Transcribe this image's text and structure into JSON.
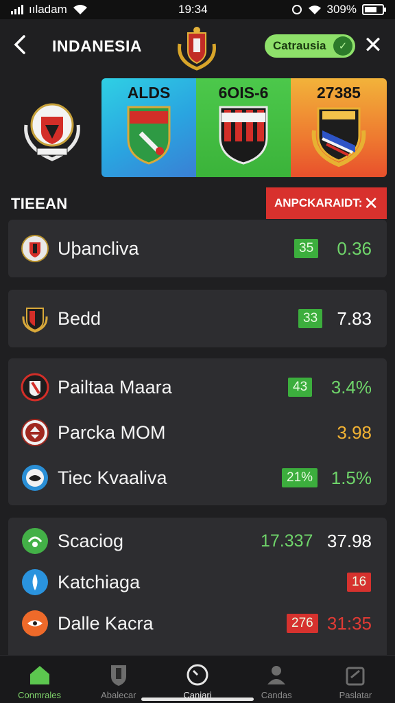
{
  "status_bar": {
    "carrier": "ııladam",
    "time": "19:34",
    "battery": "309%"
  },
  "header": {
    "title": "INDANESIA",
    "pill_label": "Catrausia"
  },
  "promo_cards": [
    {
      "title": "ALDS"
    },
    {
      "title": "6OIS-6"
    },
    {
      "title": "27385"
    }
  ],
  "section": {
    "label": "TIEEAN",
    "alert_label": "ANPCKARAIDT:"
  },
  "rows": [
    {
      "name": "Uþancliva",
      "badge": "35",
      "value": "0.36"
    },
    {
      "name": "Bedd",
      "badge": "33",
      "value": "7.83"
    },
    {
      "name": "Pailtaa Maara",
      "badge": "43",
      "value": "3.4%"
    },
    {
      "name": "Parcka MOM",
      "badge": "",
      "value": "3.98"
    },
    {
      "name": "Tiec Kvaaliva",
      "badge": "21%",
      "value": "1.5%"
    },
    {
      "name": "Scaciog",
      "badge": "17.337",
      "value": "37.98"
    },
    {
      "name": "Katchiaga",
      "badge": "16",
      "value": ""
    },
    {
      "name": "Dalle Kacra",
      "badge": "276",
      "value": "31:35"
    }
  ],
  "nav": [
    {
      "label": "Conmrales"
    },
    {
      "label": "Abalecar"
    },
    {
      "label": "Canjari"
    },
    {
      "label": "Candas"
    },
    {
      "label": "Paslatar"
    }
  ],
  "colors": {
    "accent_green": "#6fd46a",
    "alert_red": "#d8312d",
    "gold": "#f2b233",
    "background": "#1f1f21"
  },
  "icons": [
    "back-chevron-icon",
    "close-icon",
    "shield-crest-icon",
    "check-circle-icon",
    "home-icon",
    "timer-icon",
    "person-icon",
    "ticket-icon"
  ]
}
